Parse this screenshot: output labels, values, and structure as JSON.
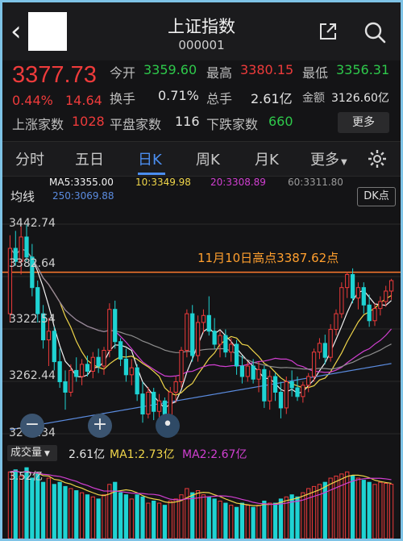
{
  "header": {
    "title": "上证指数",
    "code": "000001"
  },
  "quote": {
    "price": "3377.73",
    "change_pct": "0.44%",
    "change": "14.64",
    "stats": [
      {
        "label": "今开",
        "value": "3359.60",
        "color": "green"
      },
      {
        "label": "最高",
        "value": "3380.15",
        "color": "red"
      },
      {
        "label": "最低",
        "value": "3356.31",
        "color": "green"
      },
      {
        "label": "换手",
        "value": "0.71%",
        "color": "white"
      },
      {
        "label": "总手",
        "value": "2.61亿",
        "color": "white"
      },
      {
        "label": "金额",
        "value": "3126.60亿",
        "color": "white"
      }
    ],
    "breadth": [
      {
        "label": "上涨家数",
        "value": "1028",
        "color": "red"
      },
      {
        "label": "平盘家数",
        "value": "116",
        "color": "white"
      },
      {
        "label": "下跌家数",
        "value": "660",
        "color": "green"
      }
    ],
    "more_label": "更多"
  },
  "tabs": [
    "分时",
    "五日",
    "日K",
    "周K",
    "月K",
    "更多"
  ],
  "active_tab": "日K",
  "ma_legend": {
    "ma5": "MA5:3355.00",
    "ma10": "10:3349.98",
    "ma20": "20:3308.89",
    "ma60": "60:3311.80",
    "ma250": "250:3069.88"
  },
  "indicator_button": "均线",
  "dk_button": "DK点",
  "y_ticks": [
    "3442.74",
    "3382.64",
    "3322.54",
    "3262.44",
    "3202.34"
  ],
  "annotation": "11月10日高点3387.62点",
  "volume": {
    "tab_label": "成交量",
    "current": "2.61亿",
    "ma1": "MA1:2.73亿",
    "ma2": "MA2:2.67亿",
    "max_label": "3.52亿"
  },
  "colors": {
    "up": "#ee3b3b",
    "down": "#1fd3d3",
    "ma5": "#f2f2f2",
    "ma10": "#f0d64a",
    "ma20": "#d13fd1",
    "ma60": "#8f8f8f",
    "ma250": "#5b8ce0",
    "resistance": "#ff7a2e",
    "accent": "#4b8ef0"
  },
  "chart_data": {
    "type": "candlestick",
    "ylim": [
      3202.34,
      3442.74
    ],
    "resistance_level": 3387.62,
    "candles": [
      [
        3340,
        3430,
        3330,
        3415
      ],
      [
        3415,
        3435,
        3395,
        3400
      ],
      [
        3400,
        3440,
        3385,
        3428
      ],
      [
        3428,
        3442,
        3400,
        3405
      ],
      [
        3405,
        3420,
        3360,
        3370
      ],
      [
        3370,
        3378,
        3330,
        3340
      ],
      [
        3340,
        3350,
        3300,
        3310
      ],
      [
        3310,
        3335,
        3280,
        3320
      ],
      [
        3320,
        3325,
        3275,
        3285
      ],
      [
        3285,
        3300,
        3255,
        3262
      ],
      [
        3262,
        3275,
        3230,
        3250
      ],
      [
        3250,
        3282,
        3245,
        3275
      ],
      [
        3275,
        3290,
        3262,
        3268
      ],
      [
        3268,
        3288,
        3258,
        3282
      ],
      [
        3282,
        3292,
        3268,
        3274
      ],
      [
        3274,
        3296,
        3266,
        3290
      ],
      [
        3290,
        3300,
        3272,
        3280
      ],
      [
        3280,
        3302,
        3270,
        3298
      ],
      [
        3298,
        3352,
        3290,
        3345
      ],
      [
        3345,
        3355,
        3300,
        3308
      ],
      [
        3308,
        3312,
        3280,
        3288
      ],
      [
        3288,
        3300,
        3262,
        3270
      ],
      [
        3270,
        3288,
        3258,
        3278
      ],
      [
        3278,
        3282,
        3240,
        3248
      ],
      [
        3248,
        3262,
        3215,
        3225
      ],
      [
        3225,
        3256,
        3220,
        3250
      ],
      [
        3250,
        3255,
        3218,
        3228
      ],
      [
        3228,
        3248,
        3210,
        3240
      ],
      [
        3240,
        3244,
        3205,
        3215
      ],
      [
        3215,
        3256,
        3210,
        3250
      ],
      [
        3250,
        3268,
        3238,
        3262
      ],
      [
        3262,
        3302,
        3255,
        3298
      ],
      [
        3298,
        3345,
        3290,
        3340
      ],
      [
        3340,
        3350,
        3285,
        3292
      ],
      [
        3292,
        3338,
        3285,
        3330
      ],
      [
        3330,
        3345,
        3318,
        3338
      ],
      [
        3338,
        3360,
        3315,
        3320
      ],
      [
        3320,
        3335,
        3300,
        3305
      ],
      [
        3305,
        3320,
        3290,
        3315
      ],
      [
        3315,
        3322,
        3290,
        3296
      ],
      [
        3296,
        3312,
        3285,
        3305
      ],
      [
        3305,
        3310,
        3270,
        3280
      ],
      [
        3280,
        3292,
        3260,
        3268
      ],
      [
        3268,
        3285,
        3262,
        3280
      ],
      [
        3280,
        3288,
        3260,
        3265
      ],
      [
        3265,
        3285,
        3250,
        3276
      ],
      [
        3276,
        3280,
        3232,
        3240
      ],
      [
        3240,
        3275,
        3230,
        3268
      ],
      [
        3268,
        3272,
        3240,
        3250
      ],
      [
        3250,
        3262,
        3220,
        3232
      ],
      [
        3232,
        3268,
        3225,
        3262
      ],
      [
        3262,
        3275,
        3245,
        3255
      ],
      [
        3255,
        3268,
        3240,
        3245
      ],
      [
        3245,
        3262,
        3238,
        3258
      ],
      [
        3258,
        3272,
        3250,
        3268
      ],
      [
        3268,
        3300,
        3262,
        3296
      ],
      [
        3296,
        3312,
        3288,
        3306
      ],
      [
        3306,
        3316,
        3282,
        3290
      ],
      [
        3290,
        3328,
        3285,
        3322
      ],
      [
        3322,
        3345,
        3315,
        3340
      ],
      [
        3340,
        3376,
        3335,
        3370
      ],
      [
        3370,
        3388,
        3358,
        3385
      ],
      [
        3385,
        3392,
        3352,
        3358
      ],
      [
        3358,
        3376,
        3345,
        3370
      ],
      [
        3370,
        3376,
        3340,
        3350
      ],
      [
        3350,
        3362,
        3325,
        3332
      ],
      [
        3332,
        3352,
        3326,
        3346
      ],
      [
        3346,
        3360,
        3338,
        3354
      ],
      [
        3354,
        3372,
        3348,
        3366
      ],
      [
        3366,
        3380,
        3356,
        3378
      ]
    ],
    "volume_max": 3.52,
    "volume": [
      3.2,
      3.3,
      3.0,
      3.4,
      2.9,
      3.1,
      2.7,
      2.9,
      2.6,
      2.7,
      2.5,
      2.4,
      2.3,
      2.2,
      2.1,
      2.0,
      1.9,
      2.1,
      2.6,
      2.7,
      2.2,
      2.1,
      1.9,
      2.1,
      2.0,
      1.7,
      1.8,
      1.7,
      1.6,
      1.8,
      1.9,
      2.1,
      2.4,
      2.2,
      2.3,
      2.1,
      2.0,
      1.9,
      1.8,
      1.7,
      1.6,
      1.5,
      1.7,
      1.6,
      1.5,
      1.6,
      1.8,
      1.7,
      1.7,
      1.9,
      2.0,
      2.1,
      2.0,
      2.2,
      2.4,
      2.5,
      2.6,
      2.7,
      2.9,
      3.0,
      3.1,
      3.2,
      3.0,
      2.9,
      2.8,
      2.7,
      2.6,
      2.7,
      2.65,
      2.61
    ]
  }
}
